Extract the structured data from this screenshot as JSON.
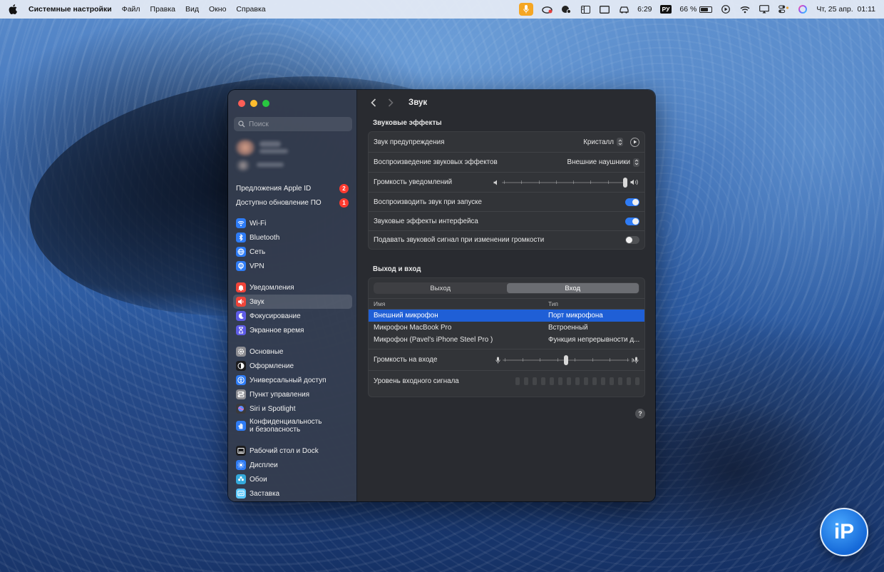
{
  "menubar": {
    "app_name": "Системные настройки",
    "menus": [
      "Файл",
      "Правка",
      "Вид",
      "Окно",
      "Справка"
    ],
    "time_short": "6:29",
    "keyboard_layout": "РУ",
    "battery_percent": "66 %",
    "battery_level": 0.66,
    "datetime": "Чт, 25 апр.  01:11",
    "icons": [
      "apple-logo",
      "microphone-active",
      "creative-cloud",
      "screen-record",
      "sidebar-menu",
      "display",
      "car-play",
      "keyboard-layout",
      "battery",
      "play",
      "wifi",
      "screen-mirroring",
      "control-center",
      "siri"
    ]
  },
  "sidebar": {
    "search_placeholder": "Поиск",
    "alerts": [
      {
        "label": "Предложения Apple ID",
        "count": "2"
      },
      {
        "label": "Доступно обновление ПО",
        "count": "1"
      }
    ],
    "groups": [
      [
        {
          "label": "Wi-Fi",
          "icon": "wifi-icon",
          "color": "#2e7cf6"
        },
        {
          "label": "Bluetooth",
          "icon": "bluetooth-icon",
          "color": "#2e7cf6"
        },
        {
          "label": "Сеть",
          "icon": "globe-icon",
          "color": "#2e7cf6"
        },
        {
          "label": "VPN",
          "icon": "vpn-globe-icon",
          "color": "#2e7cf6"
        }
      ],
      [
        {
          "label": "Уведомления",
          "icon": "bell-icon",
          "color": "#f0453a"
        },
        {
          "label": "Звук",
          "icon": "speaker-icon",
          "color": "#f0453a",
          "selected": true
        },
        {
          "label": "Фокусирование",
          "icon": "moon-icon",
          "color": "#5e5ce6"
        },
        {
          "label": "Экранное время",
          "icon": "hourglass-icon",
          "color": "#5e5ce6"
        }
      ],
      [
        {
          "label": "Основные",
          "icon": "gear-icon",
          "color": "#8e8e93"
        },
        {
          "label": "Оформление",
          "icon": "appearance-icon",
          "color": "#1c1c1e"
        },
        {
          "label": "Универсальный доступ",
          "icon": "accessibility-icon",
          "color": "#2e7cf6"
        },
        {
          "label": "Пункт управления",
          "icon": "control-center-icon",
          "color": "#8e8e93"
        },
        {
          "label": "Siri и Spotlight",
          "icon": "siri-icon",
          "color": "#3a3a3c"
        },
        {
          "label": "Конфиденциальность\nи безопасность",
          "icon": "hand-icon",
          "color": "#2e7cf6",
          "double": true
        }
      ],
      [
        {
          "label": "Рабочий стол и Dock",
          "icon": "dock-icon",
          "color": "#1c1c1e"
        },
        {
          "label": "Дисплеи",
          "icon": "sun-icon",
          "color": "#2e7cf6"
        },
        {
          "label": "Обои",
          "icon": "flower-icon",
          "color": "#34aadc"
        },
        {
          "label": "Заставка",
          "icon": "screensaver-icon",
          "color": "#5ac8fa"
        }
      ]
    ]
  },
  "main": {
    "title": "Звук",
    "effects": {
      "section_title": "Звуковые эффекты",
      "alert_sound_label": "Звук предупреждения",
      "alert_sound_value": "Кристалл",
      "playback_label": "Воспроизведение звуковых эффектов",
      "playback_value": "Внешние наушники",
      "alert_volume_label": "Громкость уведомлений",
      "alert_volume_level": 1.0,
      "startup_sound_label": "Воспроизводить звук при запуске",
      "startup_sound_on": true,
      "ui_effects_label": "Звуковые эффекты интерфейса",
      "ui_effects_on": true,
      "volume_feedback_label": "Подавать звуковой сигнал при изменении громкости",
      "volume_feedback_on": false
    },
    "io": {
      "section_title": "Выход и вход",
      "tabs": [
        {
          "label": "Выход",
          "active": false
        },
        {
          "label": "Вход",
          "active": true
        }
      ],
      "col_name": "Имя",
      "col_type": "Тип",
      "devices": [
        {
          "name": "Внешний микрофон",
          "type": "Порт микрофона",
          "selected": true
        },
        {
          "name": "Микрофон MacBook Pro",
          "type": "Встроенный",
          "selected": false
        },
        {
          "name": "Микрофон (Pavel's iPhone Steel Pro )",
          "type": "Функция непрерывности д...",
          "selected": false
        }
      ],
      "input_volume_label": "Громкость на входе",
      "input_volume_level": 0.5,
      "input_level_label": "Уровень входного сигнала",
      "input_level_segments": 15,
      "input_level_active": 0
    },
    "help_label": "?"
  },
  "watermark": "iP",
  "colors": {
    "accent": "#2f7cf6",
    "selection": "#1f5fd6",
    "badge": "#ff3b30"
  }
}
